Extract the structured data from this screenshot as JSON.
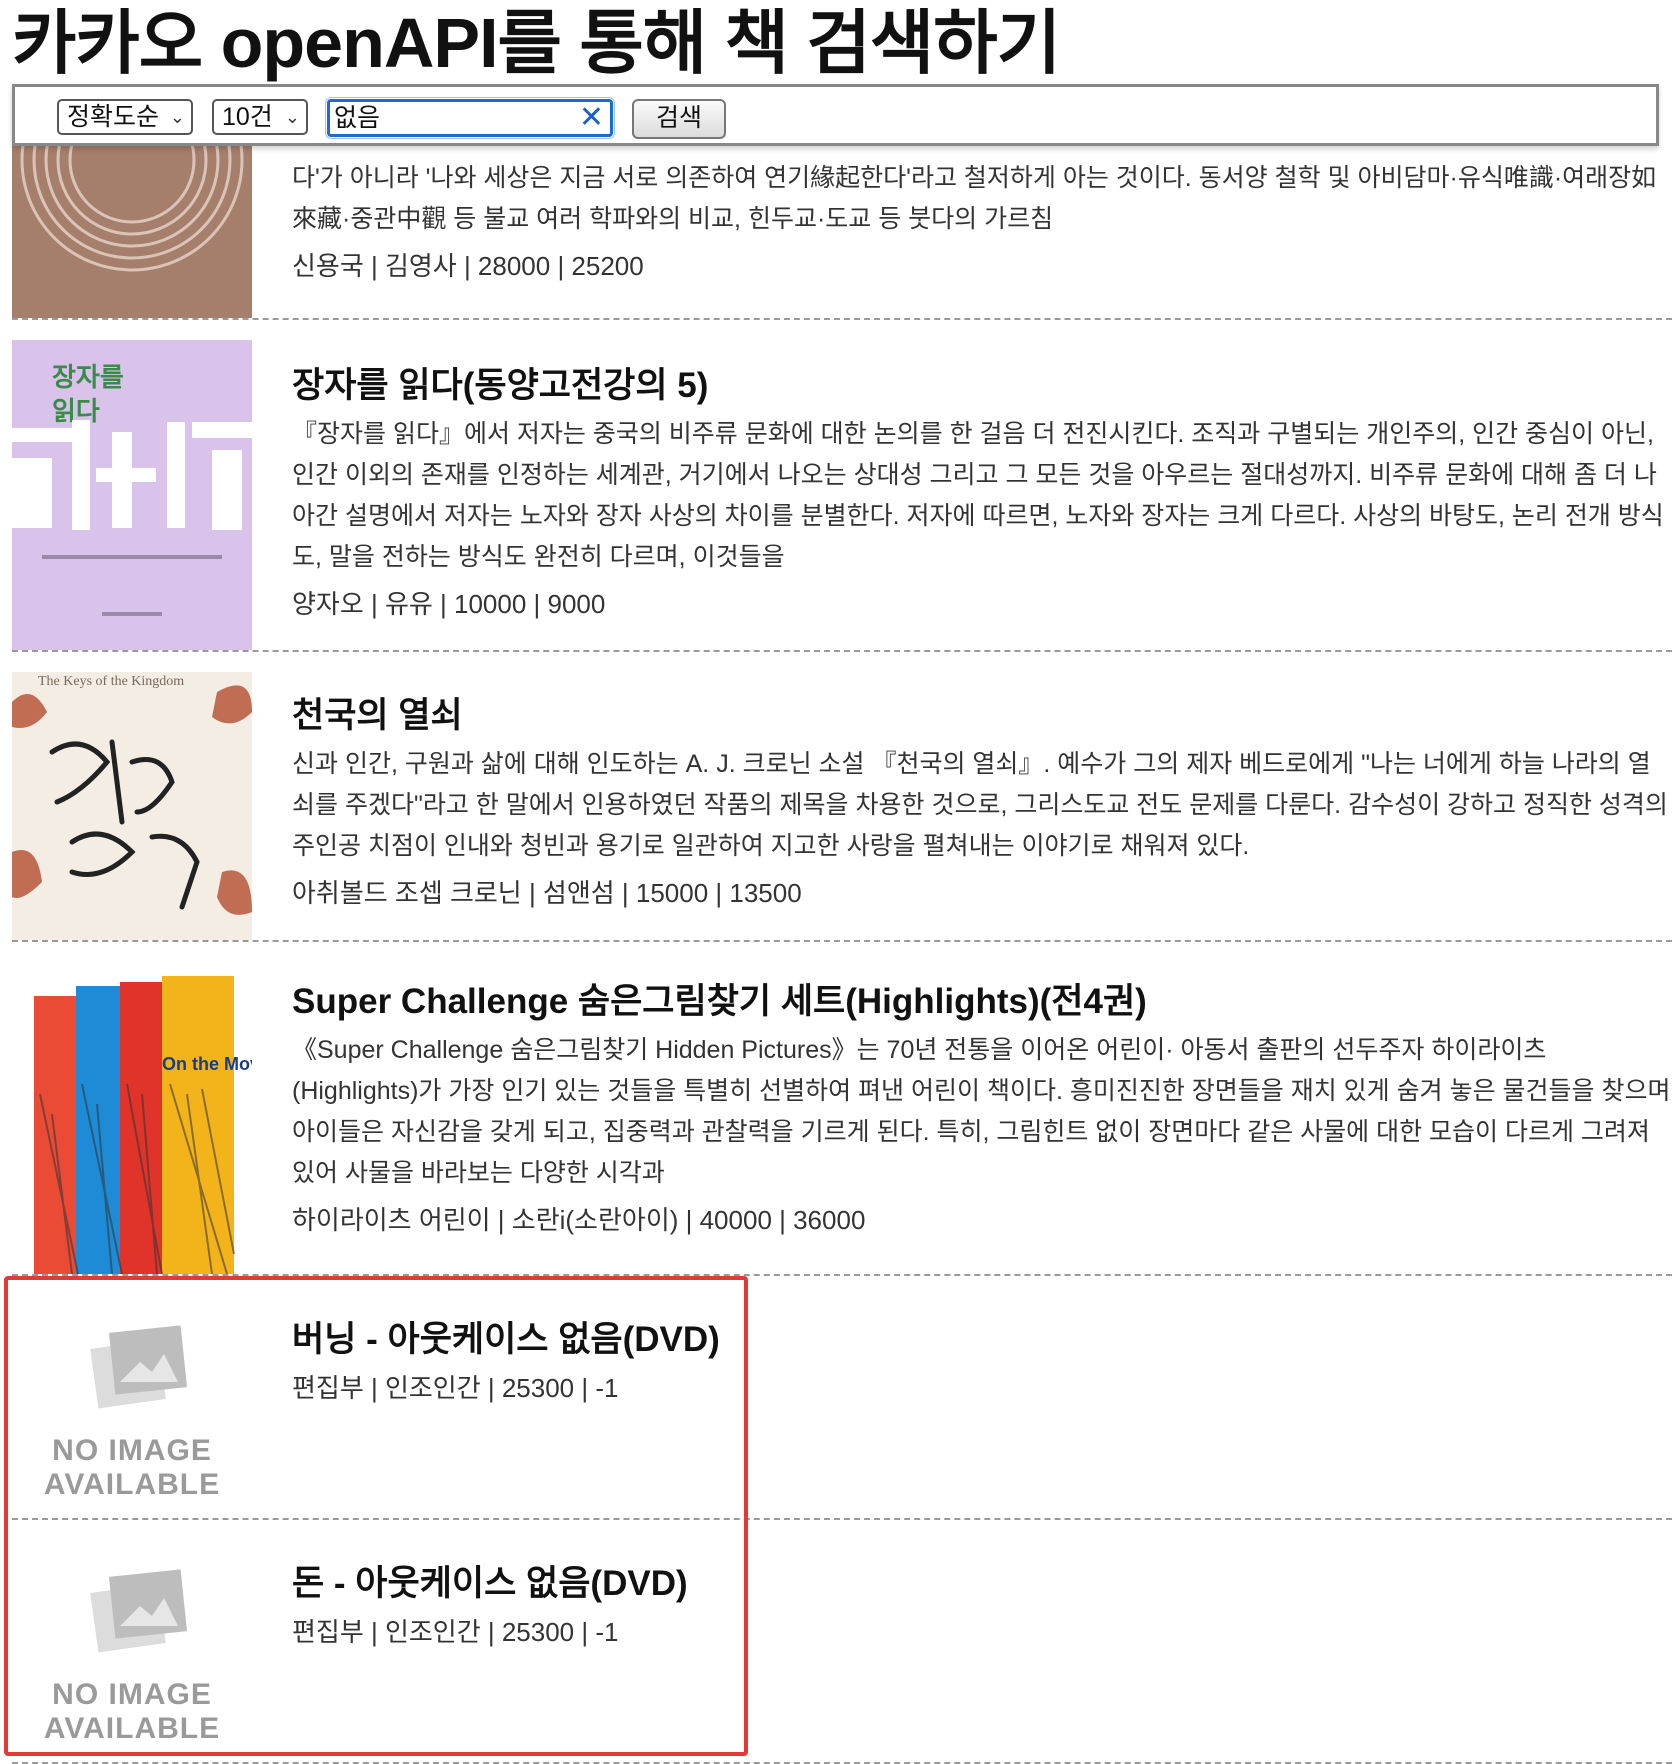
{
  "page": {
    "title": "카카오 openAPI를 통해 책 검색하기"
  },
  "search": {
    "sort_value": "정확도순",
    "size_value": "10건",
    "query": "없음",
    "button_label": "검색"
  },
  "results": [
    {
      "title": "",
      "description": "다'가 아니라 '나와 세상은 지금 서로 의존하여 연기緣起한다'라고 철저하게 아는 것이다. 동서양 철학 및 아비담마·유식唯識·여래장如來藏·중관中觀 등 불교 여러 학파와의 비교, 힌두교·도교 등 붓다의 가르침",
      "meta": "신용국 | 김영사 | 28000 | 25200"
    },
    {
      "title": "장자를 읽다(동양고전강의 5)",
      "description": "『장자를 읽다』에서 저자는 중국의 비주류 문화에 대한 논의를 한 걸음 더 전진시킨다. 조직과 구별되는 개인주의, 인간 중심이 아닌, 인간 이외의 존재를 인정하는 세계관, 거기에서 나오는 상대성 그리고 그 모든 것을 아우르는 절대성까지. 비주류 문화에 대해 좀 더 나아간 설명에서 저자는 노자와 장자 사상의 차이를 분별한다. 저자에 따르면, 노자와 장자는 크게 다르다. 사상의 바탕도, 논리 전개 방식도, 말을 전하는 방식도 완전히 다르며, 이것들을",
      "meta": "양자오 | 유유 | 10000 | 9000",
      "cover_text": "장자를\n읽다"
    },
    {
      "title": "천국의 열쇠",
      "description": "신과 인간, 구원과 삶에 대해 인도하는 A. J. 크로닌 소설 『천국의 열쇠』. 예수가 그의 제자 베드로에게 \"나는 너에게 하늘 나라의 열쇠를 주겠다\"라고 한 말에서 인용하였던 작품의 제목을 차용한 것으로, 그리스도교 전도 문제를 다룬다. 감수성이 강하고 정직한 성격의 주인공 치점이 인내와 청빈과 용기로 일관하여 지고한 사랑을 펼쳐내는 이야기로 채워져 있다.",
      "meta": "아취볼드 조셉 크로닌 | 섬앤섬 | 15000 | 13500",
      "cover_text": "The Keys of the Kingdom"
    },
    {
      "title": "Super Challenge 숨은그림찾기 세트(Highlights)(전4권)",
      "description": "《Super Challenge 숨은그림찾기 Hidden Pictures》는 70년 전통을 이어온 어린이· 아동서 출판의 선두주자 하이라이츠(Highlights)가 가장 인기 있는 것들을 특별히 선별하여 펴낸 어린이 책이다. 흥미진진한 장면들을 재치 있게 숨겨 놓은 물건들을 찾으며 아이들은 자신감을 갖게 되고, 집중력과 관찰력을 기르게 된다. 특히, 그림힌트 없이 장면마다 같은 사물에 대한 모습이 다르게 그려져 있어 사물을 바라보는 다양한 시각과",
      "meta": "하이라이츠 어린이 | 소란i(소란아이) | 40000 | 36000",
      "cover_text": "On the Move"
    },
    {
      "title": "버닝 - 아웃케이스 없음(DVD)",
      "description": "",
      "meta": "편집부 | 인조인간 | 25300 | -1",
      "no_image_label": "NO IMAGE\nAVAILABLE"
    },
    {
      "title": "돈 - 아웃케이스 없음(DVD)",
      "description": "",
      "meta": "편집부 | 인조인간 | 25300 | -1",
      "no_image_label": "NO IMAGE\nAVAILABLE"
    }
  ],
  "colors": {
    "highlight_border": "#e53935",
    "input_focus": "#1a6ad8",
    "cover_2_bg": "#d9c3ea",
    "cover_1_bg": "#a67f6c"
  }
}
